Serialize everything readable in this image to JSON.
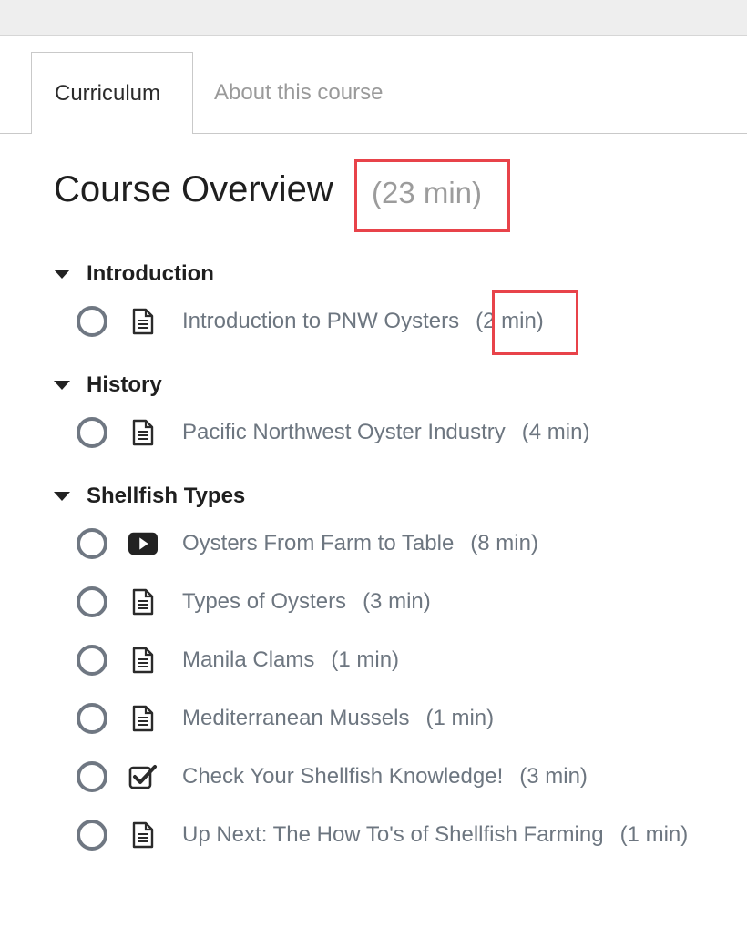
{
  "tabs": {
    "curriculum": "Curriculum",
    "about": "About this course"
  },
  "overview": {
    "title": "Course Overview",
    "duration": "(23 min)"
  },
  "sections": [
    {
      "title": "Introduction",
      "items": [
        {
          "icon": "document-icon",
          "title": "Introduction to PNW Oysters",
          "duration": "(2 min)"
        }
      ]
    },
    {
      "title": "History",
      "items": [
        {
          "icon": "document-icon",
          "title": "Pacific Northwest Oyster Industry",
          "duration": "(4 min)"
        }
      ]
    },
    {
      "title": "Shellfish Types",
      "items": [
        {
          "icon": "video-play-icon",
          "title": "Oysters From Farm to Table",
          "duration": "(8 min)"
        },
        {
          "icon": "document-icon",
          "title": "Types of Oysters",
          "duration": "(3 min)"
        },
        {
          "icon": "document-icon",
          "title": "Manila Clams",
          "duration": "(1 min)"
        },
        {
          "icon": "document-icon",
          "title": "Mediterranean Mussels",
          "duration": "(1 min)"
        },
        {
          "icon": "quiz-checkbox-icon",
          "title": "Check Your Shellfish Knowledge!",
          "duration": "(3 min)"
        },
        {
          "icon": "document-icon",
          "title": "Up Next: The How To's of Shellfish Farming",
          "duration": "(1 min)"
        }
      ]
    }
  ],
  "colors": {
    "highlight": "#e8434a",
    "muted_text": "#6d7680",
    "status_ring": "#6f7782"
  }
}
